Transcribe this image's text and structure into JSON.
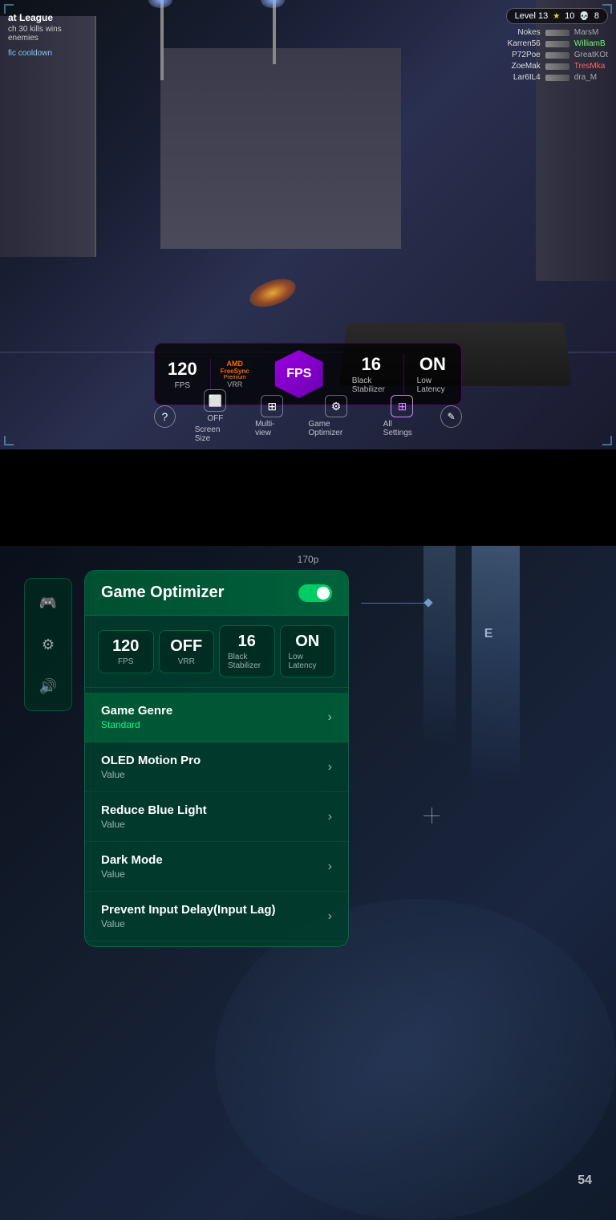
{
  "game_top": {
    "title": "at League",
    "kills": "ch 30 kills wins",
    "enemies": "enemies",
    "cooldown": "fic cooldown",
    "level": "Level 13",
    "stars": "10",
    "kills_count": "8",
    "fps_value": "120",
    "fps_label": "FPS",
    "freesync_label": "FreeSync",
    "freesync_sub": "Premium",
    "vrr_label": "VRR",
    "fps_center": "FPS",
    "black_stab_value": "16",
    "black_stab_label": "Black Stabilizer",
    "latency_value": "ON",
    "latency_label": "Low Latency",
    "screen_size_label": "Screen Size",
    "screen_size_value": "OFF",
    "multiview_label": "Multi-view",
    "game_optimizer_label": "Game Optimizer",
    "all_settings_label": "All Settings",
    "scoreboard": [
      {
        "name": "Nokes",
        "score": "MarsM",
        "color": "white"
      },
      {
        "name": "Karren56",
        "score": "WilliamB",
        "color": "green"
      },
      {
        "name": "P72Poe",
        "score": "GreatKOt",
        "color": "white"
      },
      {
        "name": "ZoeMak",
        "score": "TresMka",
        "color": "red"
      },
      {
        "name": "Lar6IL4",
        "score": "dra_M",
        "color": "white"
      }
    ]
  },
  "game_optimizer": {
    "title": "Game Optimizer",
    "toggle_state": "on",
    "fps_value": "120",
    "fps_label": "FPS",
    "vrr_value": "OFF",
    "vrr_label": "VRR",
    "black_stab_value": "16",
    "black_stab_label": "Black Stabilizer",
    "latency_value": "ON",
    "latency_label": "Low Latency",
    "menu_items": [
      {
        "id": "game_genre",
        "title": "Game Genre",
        "value": "Standard",
        "highlighted": true
      },
      {
        "id": "oled_motion_pro",
        "title": "OLED Motion Pro",
        "value": "Value",
        "highlighted": false
      },
      {
        "id": "reduce_blue_light",
        "title": "Reduce Blue Light",
        "value": "Value",
        "highlighted": false
      },
      {
        "id": "dark_mode",
        "title": "Dark Mode",
        "value": "Value",
        "highlighted": false
      },
      {
        "id": "prevent_input_delay",
        "title": "Prevent Input Delay(Input Lag)",
        "value": "Value",
        "highlighted": false
      }
    ]
  },
  "sidebar": {
    "icons": [
      {
        "id": "gamepad",
        "symbol": "🎮",
        "active": true
      },
      {
        "id": "settings",
        "symbol": "⚙",
        "active": false
      },
      {
        "id": "volume",
        "symbol": "🔊",
        "active": false
      }
    ]
  },
  "hud_numbers": {
    "ammo": "54",
    "fps_top": "170p"
  }
}
